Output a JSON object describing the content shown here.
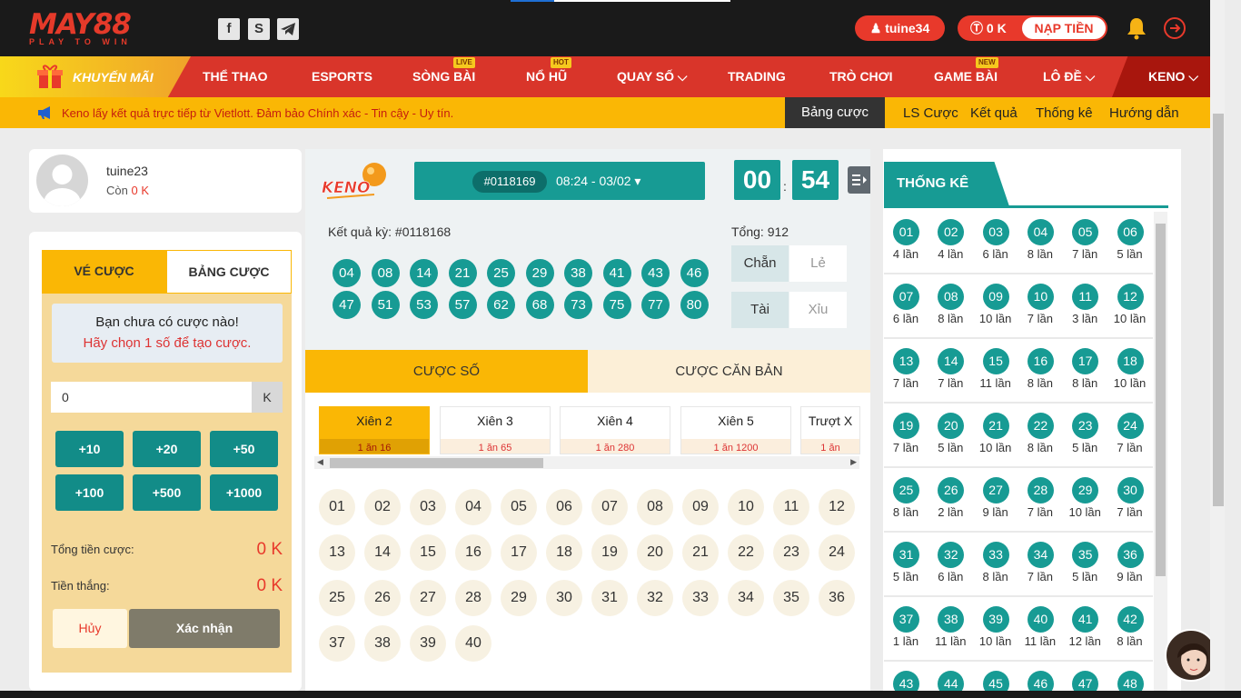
{
  "brand": {
    "logo_main": "MAY88",
    "logo_tagline": "PLAY TO WIN"
  },
  "header": {
    "username": "tuine34",
    "balance": "0 K",
    "deposit_label": "NẠP TIỀN"
  },
  "nav": {
    "promo_label": "KHUYẾN MÃI",
    "items": [
      "THỂ THAO",
      "ESPORTS",
      "SÒNG BÀI",
      "NỔ HŨ",
      "QUAY SỐ",
      "TRADING",
      "TRÒ CHƠI",
      "GAME BÀI",
      "LÔ ĐỀ",
      "KENO"
    ],
    "tags": {
      "live": "LIVE",
      "hot": "HOT",
      "new": "NEW"
    }
  },
  "notice": "Keno lấy kết quả trực tiếp từ Vietlott. Đảm bảo Chính xác - Tin cậy - Uy tín.",
  "subnav": [
    "Bảng cược",
    "LS Cược",
    "Kết quả",
    "Thống kê",
    "Hướng dẫn"
  ],
  "user": {
    "name": "tuine23",
    "balance_label": "Còn",
    "balance": "0 K"
  },
  "bet_panel": {
    "tabs": [
      "VÉ CƯỢC",
      "BẢNG CƯỢC"
    ],
    "empty_title": "Bạn chưa có cược nào!",
    "empty_hint": "Hãy chọn 1 số để tạo cược.",
    "amount": "0",
    "unit": "K",
    "chips": [
      "+10",
      "+20",
      "+50",
      "+100",
      "+500",
      "+1000"
    ],
    "total_label": "Tổng tiền cược:",
    "total_value": "0 K",
    "win_label": "Tiền thắng:",
    "win_value": "0 K",
    "cancel": "Hủy",
    "confirm": "Xác nhận"
  },
  "draw": {
    "id": "#0118169",
    "time": "08:24 - 03/02",
    "countdown_min": "00",
    "countdown_sep": ":",
    "countdown_sec": "54",
    "prev_label": "Kết quả kỳ: #0118168",
    "total_label": "Tổng: 912",
    "result_balls": [
      "04",
      "08",
      "14",
      "21",
      "25",
      "29",
      "38",
      "41",
      "43",
      "46",
      "47",
      "51",
      "53",
      "57",
      "62",
      "68",
      "73",
      "75",
      "77",
      "80"
    ],
    "side": {
      "even": "Chẵn",
      "odd": "Lẻ",
      "big": "Tài",
      "small": "Xỉu"
    }
  },
  "bet_types": {
    "tabs": [
      "CƯỢC SỐ",
      "CƯỢC CĂN BẢN"
    ],
    "cards": [
      {
        "title": "Xiên 2",
        "odds": "1 ăn 16"
      },
      {
        "title": "Xiên 3",
        "odds": "1 ăn 65"
      },
      {
        "title": "Xiên 4",
        "odds": "1 ăn 280"
      },
      {
        "title": "Xiên 5",
        "odds": "1 ăn 1200"
      },
      {
        "title": "Trượt X",
        "odds": "1 ăn"
      }
    ]
  },
  "numbers": [
    "01",
    "02",
    "03",
    "04",
    "05",
    "06",
    "07",
    "08",
    "09",
    "10",
    "11",
    "12",
    "13",
    "14",
    "15",
    "16",
    "17",
    "18",
    "19",
    "20",
    "21",
    "22",
    "23",
    "24",
    "25",
    "26",
    "27",
    "28",
    "29",
    "30",
    "31",
    "32",
    "33",
    "34",
    "35",
    "36",
    "37",
    "38",
    "39",
    "40"
  ],
  "stats": {
    "title": "THỐNG KÊ",
    "items": [
      [
        "01",
        "4 lần"
      ],
      [
        "02",
        "4 lần"
      ],
      [
        "03",
        "6 lần"
      ],
      [
        "04",
        "8 lần"
      ],
      [
        "05",
        "7 lần"
      ],
      [
        "06",
        "5 lần"
      ],
      [
        "07",
        "6 lần"
      ],
      [
        "08",
        "8 lần"
      ],
      [
        "09",
        "10 lần"
      ],
      [
        "10",
        "7 lần"
      ],
      [
        "11",
        "3 lần"
      ],
      [
        "12",
        "10 lần"
      ],
      [
        "13",
        "7 lần"
      ],
      [
        "14",
        "7 lần"
      ],
      [
        "15",
        "11 lần"
      ],
      [
        "16",
        "8 lần"
      ],
      [
        "17",
        "8 lần"
      ],
      [
        "18",
        "10 lần"
      ],
      [
        "19",
        "7 lần"
      ],
      [
        "20",
        "5 lần"
      ],
      [
        "21",
        "10 lần"
      ],
      [
        "22",
        "8 lần"
      ],
      [
        "23",
        "5 lần"
      ],
      [
        "24",
        "7 lần"
      ],
      [
        "25",
        "8 lần"
      ],
      [
        "26",
        "2 lần"
      ],
      [
        "27",
        "9 lần"
      ],
      [
        "28",
        "7 lần"
      ],
      [
        "29",
        "10 lần"
      ],
      [
        "30",
        "7 lần"
      ],
      [
        "31",
        "5 lần"
      ],
      [
        "32",
        "6 lần"
      ],
      [
        "33",
        "8 lần"
      ],
      [
        "34",
        "7 lần"
      ],
      [
        "35",
        "5 lần"
      ],
      [
        "36",
        "9 lần"
      ],
      [
        "37",
        "1 lần"
      ],
      [
        "38",
        "11 lần"
      ],
      [
        "39",
        "10 lần"
      ],
      [
        "40",
        "11 lần"
      ],
      [
        "41",
        "12 lần"
      ],
      [
        "42",
        "8 lần"
      ],
      [
        "43",
        ""
      ],
      [
        "44",
        ""
      ],
      [
        "45",
        ""
      ],
      [
        "46",
        ""
      ],
      [
        "47",
        ""
      ],
      [
        "48",
        ""
      ]
    ]
  },
  "colors": {
    "teal": "#179b94",
    "yellow": "#fab705",
    "red": "#d9352a"
  }
}
